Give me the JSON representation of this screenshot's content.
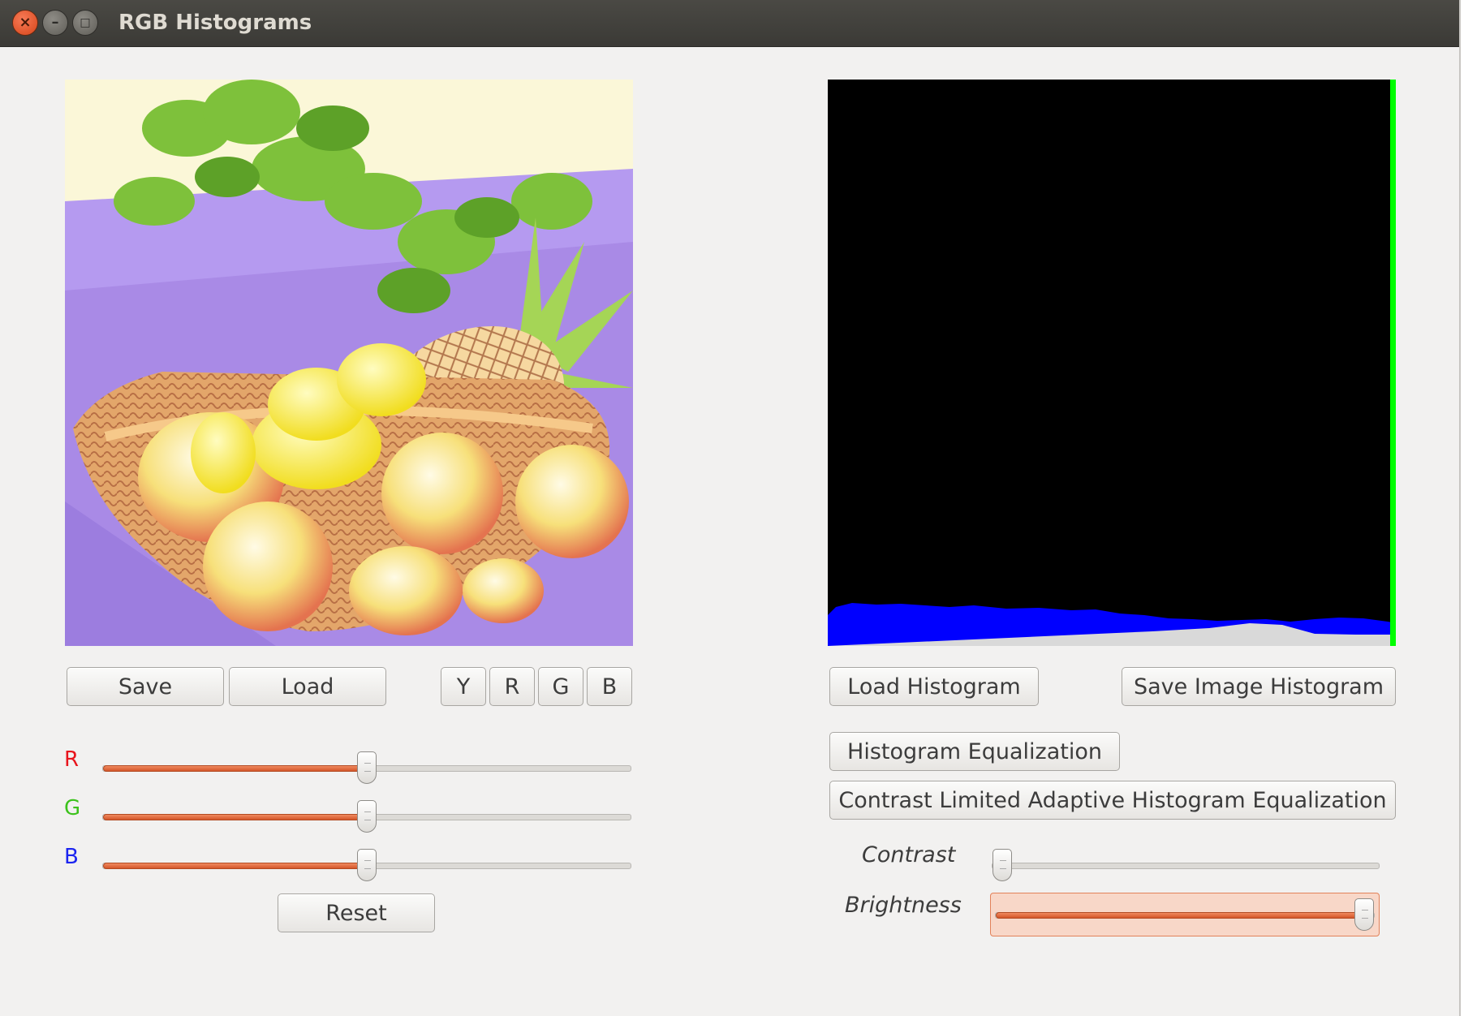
{
  "window": {
    "title": "RGB Histograms"
  },
  "icons": {
    "close": "close-icon",
    "minimize": "minimize-icon",
    "maximize": "maximize-icon"
  },
  "left": {
    "save_label": "Save",
    "load_label": "Load",
    "channel_buttons": [
      "Y",
      "R",
      "G",
      "B"
    ],
    "sliders": [
      {
        "label": "R",
        "color": "#e8141c",
        "value": 0.5
      },
      {
        "label": "G",
        "color": "#3cc21c",
        "value": 0.5
      },
      {
        "label": "B",
        "color": "#1b24f0",
        "value": 0.5
      }
    ],
    "reset_label": "Reset"
  },
  "right": {
    "load_histogram_label": "Load Histogram",
    "save_image_histogram_label": "Save Image Histogram",
    "histogram_equalization_label": "Histogram Equalization",
    "clahe_label": "Contrast Limited Adaptive Histogram Equalization",
    "contrast": {
      "label": "Contrast",
      "value": 0.0
    },
    "brightness": {
      "label": "Brightness",
      "value": 1.0
    }
  },
  "colors": {
    "accent": "#e0652f",
    "histogram_blue": "#0000ff",
    "histogram_green": "#00ff00"
  }
}
